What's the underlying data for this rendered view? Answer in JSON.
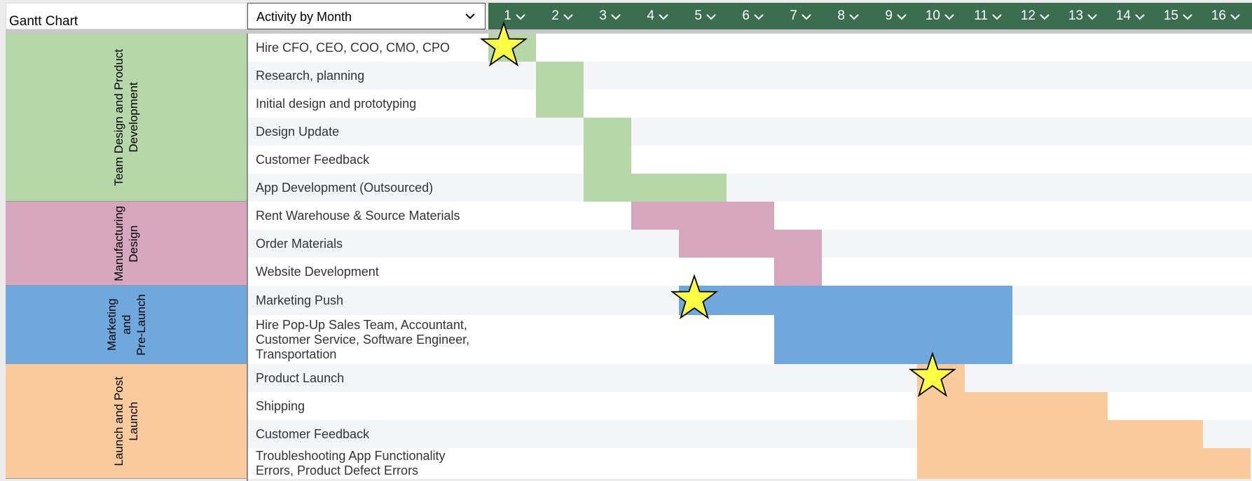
{
  "sheet": {
    "title": "Gantt Chart",
    "view_selector": {
      "selected": "Activity by Month"
    }
  },
  "months": [
    "1",
    "2",
    "3",
    "4",
    "5",
    "6",
    "7",
    "8",
    "9",
    "10",
    "11",
    "12",
    "13",
    "14",
    "15",
    "16"
  ],
  "groups": [
    {
      "label": "Team Design and Product\nDevelopment",
      "color": "#b6d7a8",
      "first_row": 0,
      "row_count": 6
    },
    {
      "label": "Manufacturing\nDesign",
      "color": "#d5a6bd",
      "first_row": 6,
      "row_count": 3
    },
    {
      "label": "Marketing\nand\nPre-Launch",
      "color": "#6fa8dc",
      "first_row": 9,
      "row_count": 2
    },
    {
      "label": "Launch and Post\nLaunch",
      "color": "#f9cb9c",
      "first_row": 11,
      "row_count": 4
    }
  ],
  "tasks": [
    {
      "name": "Hire CFO, CEO, COO, CMO, CPO",
      "start": 1,
      "end": 1,
      "group": 0
    },
    {
      "name": "Research, planning",
      "start": 2,
      "end": 2,
      "group": 0
    },
    {
      "name": "Initial design and prototyping",
      "start": 2,
      "end": 2,
      "group": 0
    },
    {
      "name": "Design Update",
      "start": 3,
      "end": 3,
      "group": 0
    },
    {
      "name": "Customer Feedback",
      "start": 3,
      "end": 3,
      "group": 0
    },
    {
      "name": "App Development (Outsourced)",
      "start": 3,
      "end": 5,
      "group": 0
    },
    {
      "name": "Rent Warehouse & Source Materials",
      "start": 4,
      "end": 6,
      "group": 1
    },
    {
      "name": "Order Materials",
      "start": 5,
      "end": 7,
      "group": 1
    },
    {
      "name": "Website Development",
      "start": 7,
      "end": 7,
      "group": 1
    },
    {
      "name": "Marketing Push",
      "start": 5,
      "end": 11,
      "group": 2
    },
    {
      "name": "Hire Pop-Up Sales Team, Accountant, Customer Service, Software Engineer, Transportation",
      "start": 7,
      "end": 11,
      "group": 2
    },
    {
      "name": "Product Launch",
      "start": 10,
      "end": 10,
      "group": 3
    },
    {
      "name": "Shipping",
      "start": 10,
      "end": 13,
      "group": 3
    },
    {
      "name": "Customer Feedback",
      "start": 10,
      "end": 15,
      "group": 3
    },
    {
      "name": "Troubleshooting App Functionality Errors, Product Defect Errors",
      "start": 10,
      "end": 16,
      "group": 3
    }
  ],
  "milestones": [
    {
      "task": 0,
      "month": 1,
      "icon": "star-icon",
      "color": "#ffff44"
    },
    {
      "task": 9,
      "month": 5,
      "icon": "star-icon",
      "color": "#ffff44"
    },
    {
      "task": 11,
      "month": 10,
      "icon": "star-icon",
      "color": "#ffff44"
    }
  ]
}
